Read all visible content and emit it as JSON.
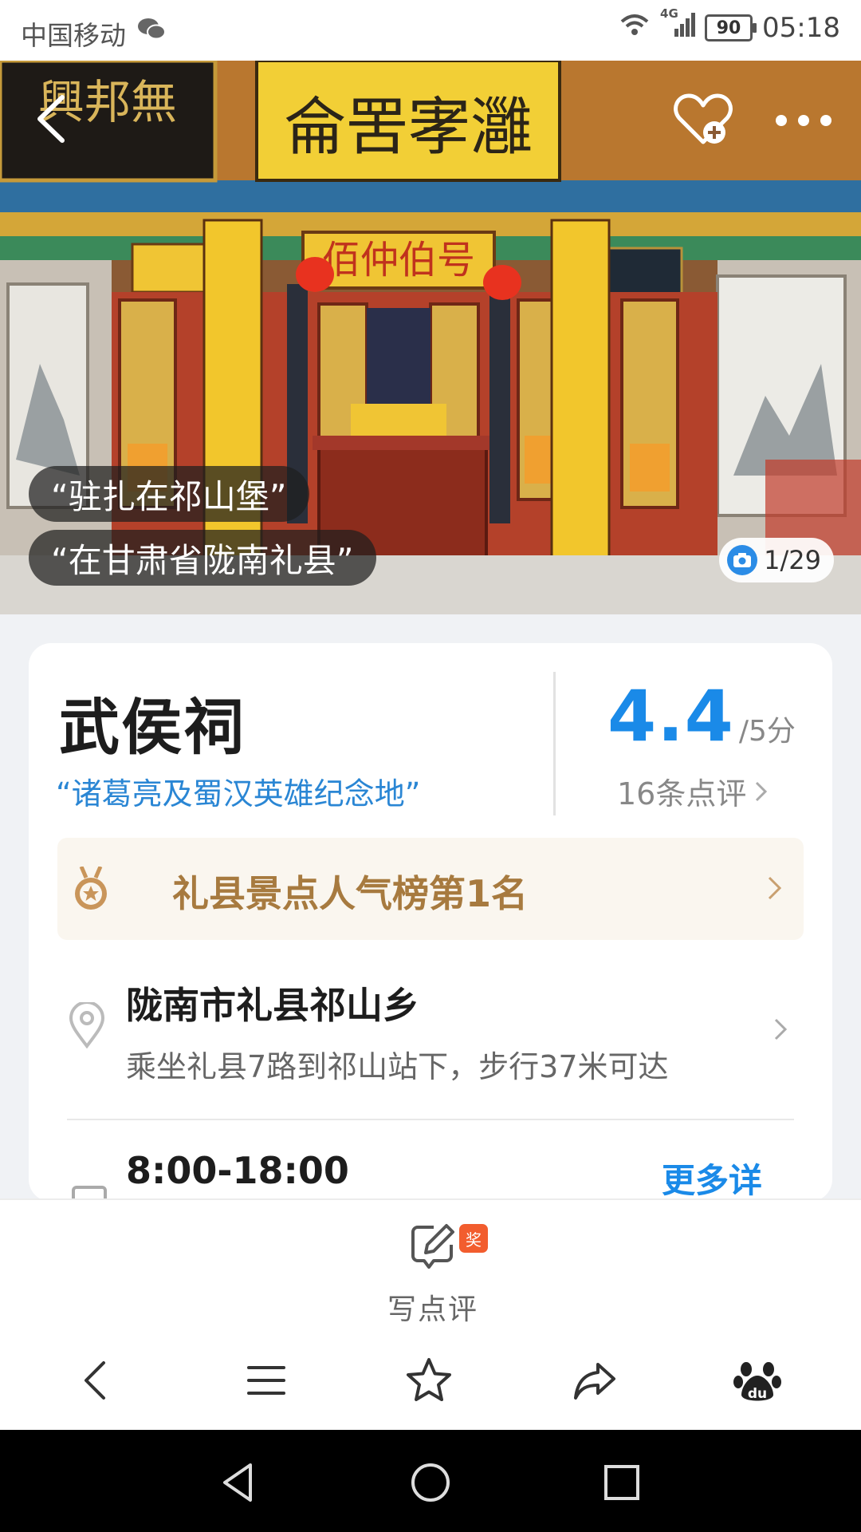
{
  "status_bar": {
    "carrier": "中国移动",
    "network": "4G",
    "battery": "90",
    "time": "05:18"
  },
  "hero": {
    "tags": [
      "“驻扎在祁山堡”",
      "“在甘肃省陇南礼县”"
    ],
    "photo_counter": "1/29",
    "banner_text": "侖罟宯灉",
    "plaque_text": "佰仲伯号",
    "left_plaque": "興邦無"
  },
  "poi": {
    "name": "武侯祠",
    "tagline": "“诸葛亮及蜀汉英雄纪念地”",
    "score": "4.4",
    "score_unit": "/5分",
    "review_count": "16条点评",
    "ranking": "礼县景点人气榜第1名",
    "address": "陇南市礼县祁山乡",
    "transit": "乘坐礼县7路到祁山站下，步行37米可达",
    "hours": "8:00-18:00",
    "more_detail": "更多详"
  },
  "write_review": {
    "label": "写点评",
    "badge": "奖"
  },
  "colors": {
    "accent": "#1a8ae8",
    "rank_text": "#a77a3f",
    "rank_bg": "#faf6ef",
    "badge": "#f25d2e"
  },
  "icons": {
    "toolbar": [
      "back-icon",
      "menu-icon",
      "star-icon",
      "share-icon",
      "baidu-paw-icon"
    ],
    "nav": [
      "nav-back-icon",
      "nav-home-icon",
      "nav-recents-icon"
    ]
  }
}
